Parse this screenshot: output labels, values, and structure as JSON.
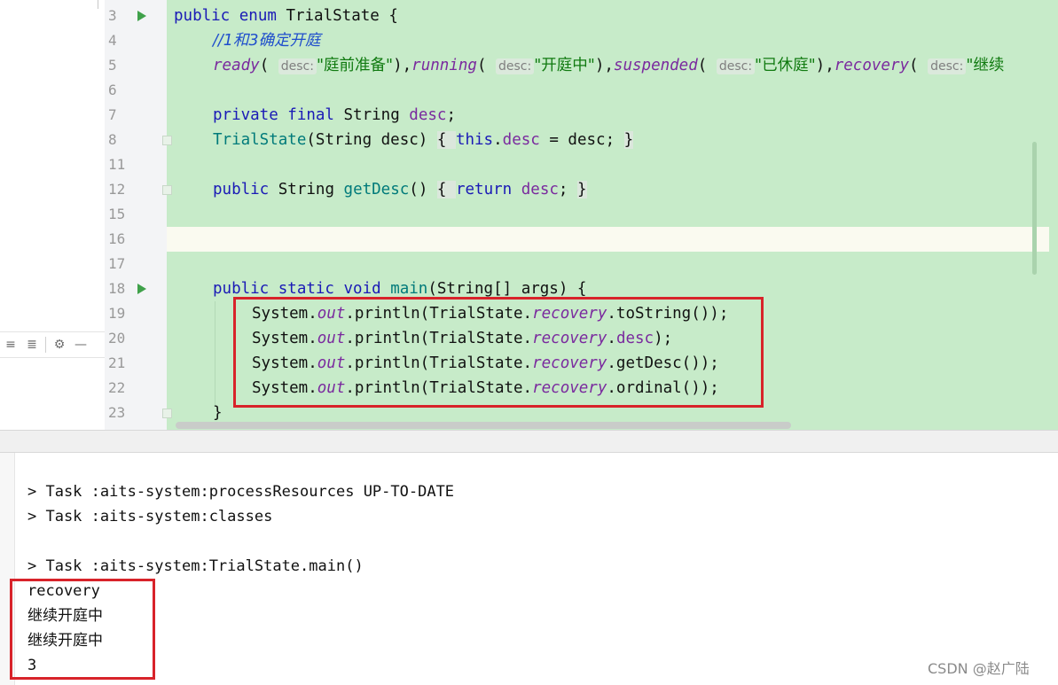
{
  "editor": {
    "lines": [
      {
        "num": "3"
      },
      {
        "num": "4"
      },
      {
        "num": "5"
      },
      {
        "num": "6"
      },
      {
        "num": "7"
      },
      {
        "num": "8"
      },
      {
        "num": "11"
      },
      {
        "num": "12"
      },
      {
        "num": "15"
      },
      {
        "num": "16"
      },
      {
        "num": "17"
      },
      {
        "num": "18"
      },
      {
        "num": "19"
      },
      {
        "num": "20"
      },
      {
        "num": "21"
      },
      {
        "num": "22"
      },
      {
        "num": "23"
      }
    ],
    "code": {
      "l3": {
        "kw": "public enum ",
        "name": "TrialState {"
      },
      "l4": {
        "comment": "//1和3确定开庭"
      },
      "l5": {
        "ready": "ready",
        "running": "running",
        "suspended": "suspended",
        "recovery": "recovery",
        "hint": "desc:",
        "s1": "\"庭前准备\"",
        "s2": "\"开庭中\"",
        "s3": "\"已休庭\"",
        "s4": "\"继续"
      },
      "l7": {
        "kw": "private final ",
        "type": "String ",
        "field": "desc",
        "end": ";"
      },
      "l8": {
        "ctor": "TrialState",
        "params": "(String desc) ",
        "open": "{ ",
        "this": "this",
        "rest": ".",
        "field": "desc",
        "assign": " = desc; ",
        "close": "}"
      },
      "l12": {
        "kw": "public ",
        "type": "String ",
        "fn": "getDesc",
        "paren": "() ",
        "open": "{ ",
        "ret": "return ",
        "field": "desc",
        "semi": "; ",
        "close": "}"
      },
      "l18": {
        "kw": "public static void ",
        "fn": "main",
        "rest": "(String[] args) {"
      },
      "l19": {
        "a": "System.",
        "out": "out",
        "b": ".println(TrialState.",
        "rec": "recovery",
        "c": ".toString());"
      },
      "l20": {
        "a": "System.",
        "out": "out",
        "b": ".println(TrialState.",
        "rec": "recovery",
        "c": ".",
        "f": "desc",
        "d": ");"
      },
      "l21": {
        "a": "System.",
        "out": "out",
        "b": ".println(TrialState.",
        "rec": "recovery",
        "c": ".getDesc());"
      },
      "l22": {
        "a": "System.",
        "out": "out",
        "b": ".println(TrialState.",
        "rec": "recovery",
        "c": ".ordinal());"
      },
      "l23": {
        "close": "}"
      }
    }
  },
  "console": {
    "lines": [
      "> Task :aits-system:processResources UP-TO-DATE",
      "> Task :aits-system:classes",
      "> Task :aits-system:TrialState.main()",
      "recovery",
      "继续开庭中",
      "继续开庭中",
      "3"
    ]
  },
  "watermark": "CSDN @赵广陆",
  "colors": {
    "highlight_box": "#d8232a",
    "editor_bg": "#c7ebc9",
    "run_icon": "#3fa14a"
  }
}
